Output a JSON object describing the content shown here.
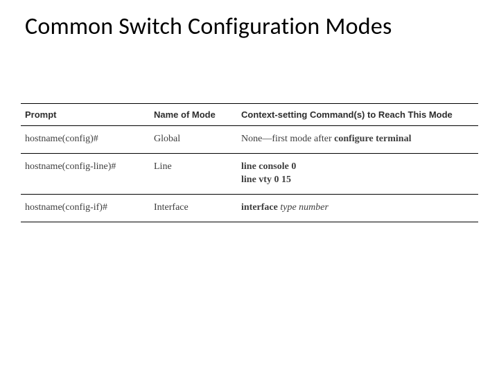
{
  "title": "Common Switch Configuration Modes",
  "table": {
    "headers": {
      "prompt": "Prompt",
      "mode": "Name of Mode",
      "command": "Context-setting Command(s) to Reach This Mode"
    },
    "rows": [
      {
        "prompt": "hostname(config)#",
        "mode": "Global",
        "cmd_prefix": "None—first mode after ",
        "cmd_bold": "configure terminal",
        "cmd_italic": ""
      },
      {
        "prompt": "hostname(config-line)#",
        "mode": "Line",
        "cmd_line1_bold": "line console 0",
        "cmd_line2_bold": "line vty 0 15"
      },
      {
        "prompt": "hostname(config-if)#",
        "mode": "Interface",
        "cmd_bold": "interface",
        "cmd_italic": " type number"
      }
    ]
  }
}
